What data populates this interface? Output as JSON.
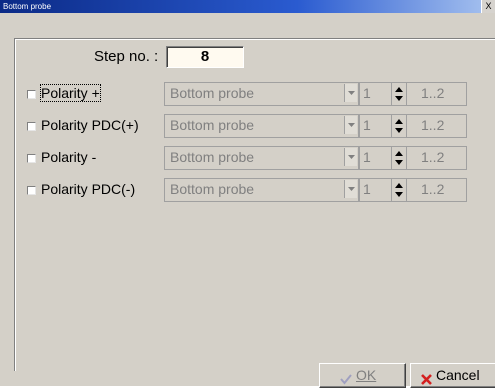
{
  "window": {
    "title": "Bottom probe",
    "close_label": "X"
  },
  "step": {
    "label": "Step no. :",
    "value": "8"
  },
  "rows": [
    {
      "label": "Polarity  +",
      "probe": "Bottom probe",
      "number": "1",
      "range": "1..2",
      "checked": false,
      "focused": true
    },
    {
      "label": "Polarity PDC(+)",
      "probe": "Bottom probe",
      "number": "1",
      "range": "1..2",
      "checked": false,
      "focused": false
    },
    {
      "label": "Polarity  -",
      "probe": "Bottom probe",
      "number": "1",
      "range": "1..2",
      "checked": false,
      "focused": false
    },
    {
      "label": "Polarity PDC(-)",
      "probe": "Bottom probe",
      "number": "1",
      "range": "1..2",
      "checked": false,
      "focused": false
    }
  ],
  "buttons": {
    "ok_label": "OK",
    "cancel_label": "Cancel"
  },
  "icons": {
    "ok": "checkmark-icon",
    "cancel": "x-mark-icon",
    "dropdown": "chevron-down-icon",
    "spinner": "spin-updown-icon"
  },
  "colors": {
    "title_bar": "#0b2a86",
    "dialog_bg": "#d4d0c8",
    "disabled_text": "#808080",
    "cancel_icon": "#d42020",
    "ok_icon": "#a0a0c0"
  }
}
